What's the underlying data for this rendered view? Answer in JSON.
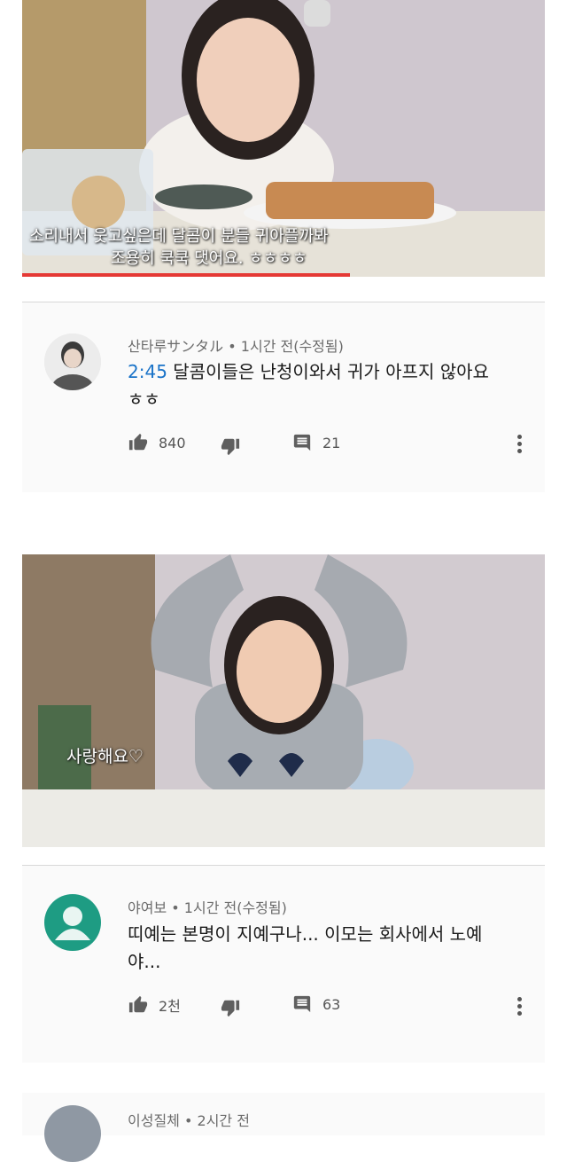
{
  "video1": {
    "caption_line1": "소리내서 웃고싶은데 달콤이 분들 귀아플까봐",
    "caption_line2": "조용히 쿡쿡 댓어요. ㅎㅎㅎㅎ"
  },
  "comment1": {
    "author": "산타루サンタル",
    "time": "• 1시간 전(수정됨)",
    "timestamp": "2:45",
    "text": " 달콤이들은 난청이와서 귀가 아프지 않아요 ㅎㅎ",
    "likes": "840",
    "replies": "21"
  },
  "video2": {
    "caption": "사랑해요♡"
  },
  "comment2": {
    "author": "야여보",
    "time": "• 1시간 전(수정됨)",
    "text": "띠예는 본명이 지예구나... 이모는 회사에서 노예야...",
    "likes": "2천",
    "replies": "63"
  },
  "comment3": {
    "author": "이성질체",
    "time": "• 2시간 전"
  },
  "colors": {
    "timestamp_link": "#1a73c8",
    "progress": "#e53935",
    "default_avatar": "#1e9c83"
  },
  "icons": [
    "thumb-up-icon",
    "thumb-down-icon",
    "reply-icon",
    "more-vert-icon",
    "default-avatar-icon"
  ]
}
